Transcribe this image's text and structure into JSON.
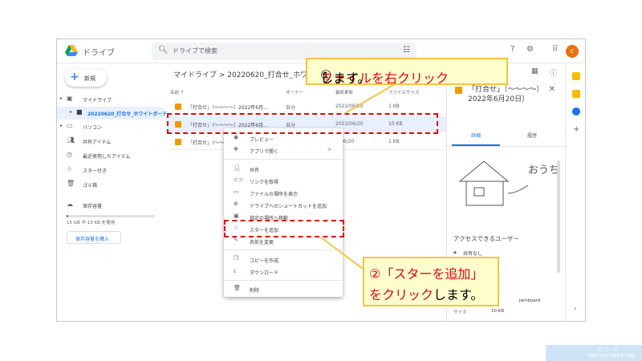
{
  "app": {
    "title": "ドライブ",
    "avatar_letter": "c"
  },
  "search": {
    "placeholder": "ドライブで検索"
  },
  "sidebar": {
    "new_label": "新規",
    "items": [
      {
        "label": "マイドライブ",
        "icon": "my-drive-icon"
      },
      {
        "label": "20220620_打合せ_ホワイトボード",
        "icon": "folder-icon"
      },
      {
        "label": "パソコン",
        "icon": "computer-icon"
      },
      {
        "label": "共有アイテム",
        "icon": "shared-icon"
      },
      {
        "label": "最近使用したアイテム",
        "icon": "recent-icon"
      },
      {
        "label": "スター付き",
        "icon": "star-icon"
      },
      {
        "label": "ゴミ箱",
        "icon": "trash-icon"
      },
      {
        "label": "保存容量",
        "icon": "cloud-icon"
      }
    ],
    "storage_text": "15 GB 中 13 KB を使用",
    "storage_fraction": 0.01,
    "buy_storage": "保存容量を購入"
  },
  "main": {
    "breadcrumb": "マイドライブ  >  20220620_打合せ_ホワイト",
    "columns": {
      "name": "名前 ↑",
      "owner": "オーナー",
      "modified": "最終更新",
      "size": "ファイルサイズ"
    },
    "rows": [
      {
        "name": "「打合せ」（〜〜〜〜）2022年6月...",
        "owner": "自分",
        "modified": "2022/06/20",
        "size": "1 KB"
      },
      {
        "name": "「打合せ」（〜〜〜〜）2022年6月...",
        "owner": "自分",
        "modified": "2022/06/20",
        "size": "10 KB"
      },
      {
        "name": "「打合せ」（〜〜〜",
        "owner": "",
        "modified": "2/06/20",
        "size": "1 KB"
      }
    ]
  },
  "context_menu": {
    "items": [
      {
        "label": "プレビュー",
        "icon": "eye-icon"
      },
      {
        "label": "アプリで開く",
        "icon": "move-icon",
        "submenu": ">"
      },
      {
        "label": "共有",
        "icon": "person-add-icon"
      },
      {
        "label": "リンクを取得",
        "icon": "link-icon"
      },
      {
        "label": "ファイルの場所を表示",
        "icon": "folder-icon"
      },
      {
        "label": "ドライブへのショートカットを追加",
        "icon": "shortcut-icon"
      },
      {
        "label": "指定の場所へ移動",
        "icon": "move-to-icon"
      },
      {
        "label": "スターを追加",
        "icon": "star-icon"
      },
      {
        "label": "名前を変更",
        "icon": "pencil-icon"
      },
      {
        "label": "コピーを作成",
        "icon": "copy-icon"
      },
      {
        "label": "ダウンロード",
        "icon": "download-icon"
      },
      {
        "label": "削除",
        "icon": "trash-icon"
      }
    ]
  },
  "details": {
    "title": "「打合せ」（〜〜〜〜）2022年6月20日）",
    "tab_details": "詳細",
    "tab_activity": "履歴",
    "access_title": "アクセスできるユーザー",
    "private": "共有なし",
    "app": "Jamboard",
    "size_label": "サイズ",
    "size_value": "10 KB"
  },
  "annotations": {
    "step1_num": "①",
    "step1_red": "ファイルを右クリック",
    "step1_rest": "します。",
    "step2_l1_red": "②「スターを追加」",
    "step2_l2_red": "をクリック",
    "step2_l2_rest": "します。"
  },
  "footer": {
    "line1": "IT ロード",
    "line2": "知識ゼロから始めるIT講座"
  },
  "colors": {
    "highlight": "#e60012",
    "callout_bg": "#ffffcc",
    "accent": "#1a73e8"
  }
}
